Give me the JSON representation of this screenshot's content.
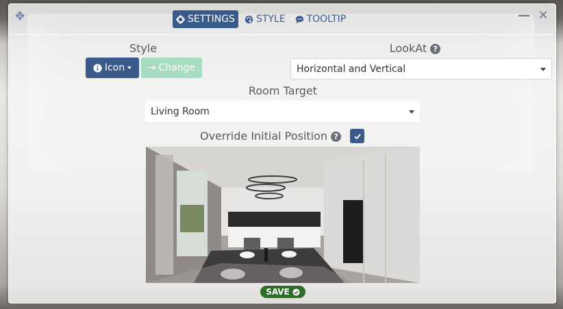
{
  "tabs": [
    {
      "label": "SETTINGS",
      "icon": "gear-icon",
      "active": true
    },
    {
      "label": "STYLE",
      "icon": "palette-icon",
      "active": false
    },
    {
      "label": "TOOLTIP",
      "icon": "comment-icon",
      "active": false
    }
  ],
  "style_section": {
    "label": "Style",
    "icon_button_label": "Icon",
    "change_button_label": "Change"
  },
  "lookat": {
    "label": "LookAt",
    "help": "?",
    "value": "Horizontal and Vertical"
  },
  "room_target": {
    "label": "Room Target",
    "value": "Living Room"
  },
  "override": {
    "label": "Override Initial Position",
    "help": "?",
    "checked": true
  },
  "save_label": "SAVE",
  "colors": {
    "primary": "#3a5a8c",
    "change_disabled": "#a7dcc0",
    "save": "#2f6b2a"
  }
}
